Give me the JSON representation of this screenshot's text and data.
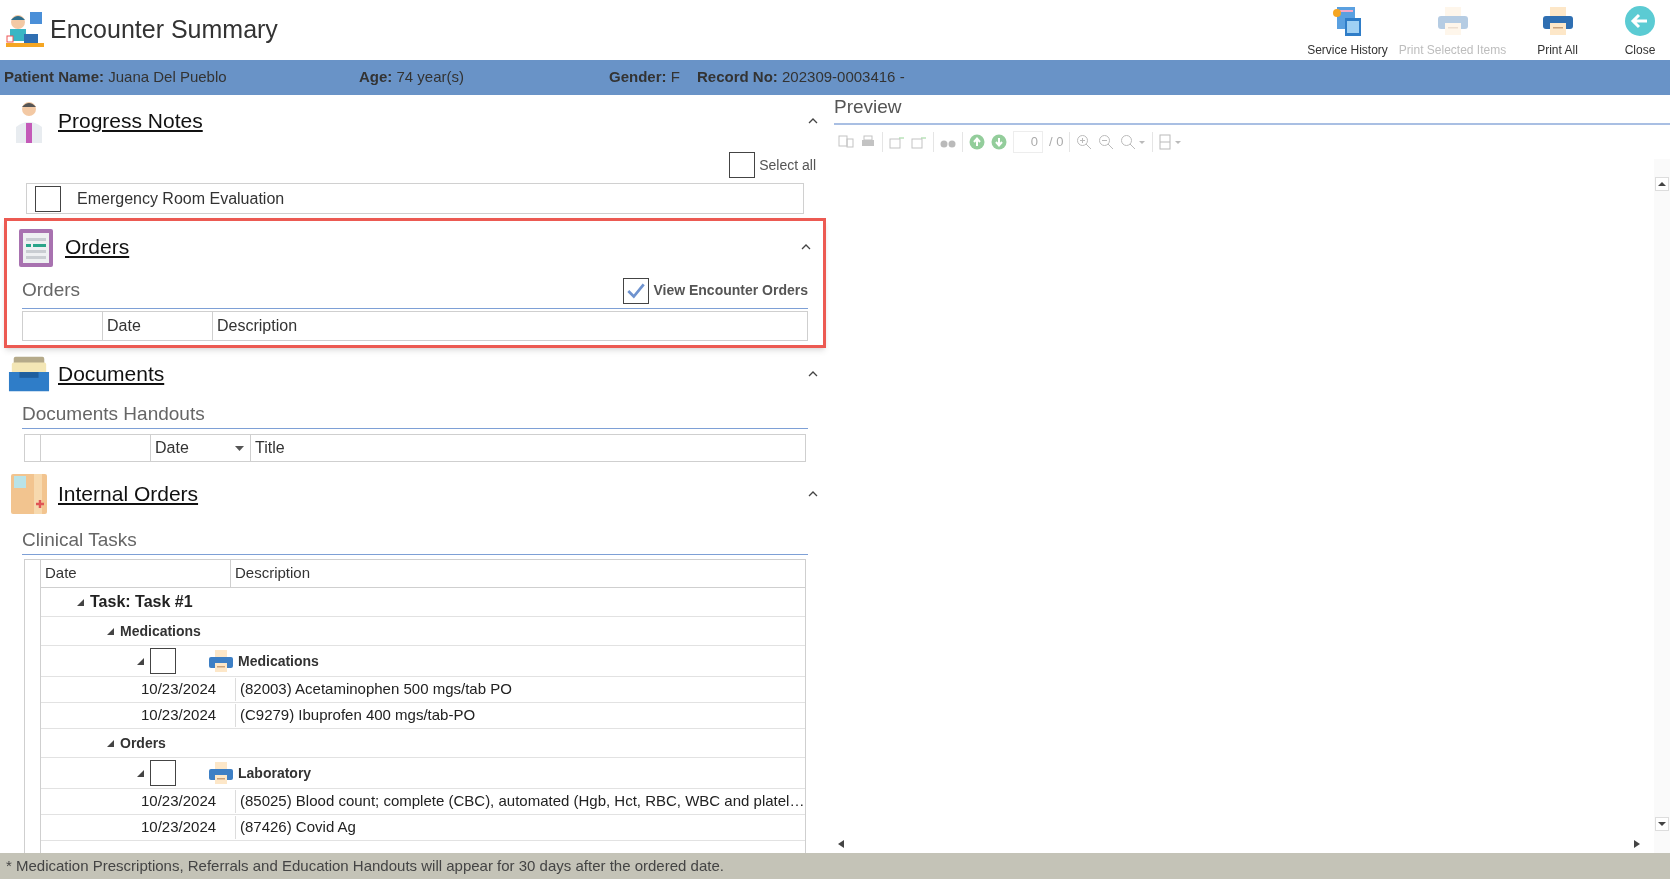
{
  "header": {
    "title": "Encounter Summary",
    "toolbar_buttons": [
      {
        "kind": "history",
        "label": "Service History",
        "disabled": false
      },
      {
        "kind": "print",
        "label": "Print Selected Items",
        "disabled": true
      },
      {
        "kind": "print",
        "label": "Print All",
        "disabled": false
      },
      {
        "kind": "close",
        "label": "Close",
        "disabled": false
      }
    ]
  },
  "patient_bar": [
    {
      "label": "Patient Name:",
      "value": "Juana Del Pueblo"
    },
    {
      "label": "Age:",
      "value": "74 year(s)"
    },
    {
      "label": "Gender:",
      "value": "F"
    },
    {
      "label": "Record No:",
      "value": "202309-0003416 -"
    }
  ],
  "progress_notes": {
    "title": "Progress Notes",
    "expanded": true,
    "select_all": {
      "label": "Select all",
      "checked": false
    },
    "items": [
      {
        "label": "Emergency Room Evaluation",
        "checked": false
      }
    ]
  },
  "orders": {
    "title": "Orders",
    "expanded": true,
    "highlighted": true,
    "subtitle": "Orders",
    "view_encounter_orders": {
      "label": "View Encounter Orders",
      "checked": true
    },
    "columns": [
      "Date",
      "Description"
    ]
  },
  "documents": {
    "title": "Documents",
    "expanded": true,
    "subtitle": "Documents Handouts",
    "columns": [
      {
        "label": "Date",
        "sortable": true
      },
      {
        "label": "Title",
        "sortable": false
      }
    ]
  },
  "internal_orders": {
    "title": "Internal Orders",
    "expanded": true,
    "subtitle": "Clinical Tasks",
    "columns": [
      "Date",
      "Description"
    ],
    "tree": [
      {
        "kind": "task",
        "label": "Task: Task #1",
        "expanded": true,
        "children": [
          {
            "kind": "group",
            "label": "Medications",
            "expanded": true,
            "children": [
              {
                "kind": "category",
                "label": "Medications",
                "expanded": true,
                "checked": false,
                "children": [
                  {
                    "kind": "item",
                    "date": "10/23/2024",
                    "description": "(82003) Acetaminophen 500 mgs/tab PO"
                  },
                  {
                    "kind": "item",
                    "date": "10/23/2024",
                    "description": "(C9279) Ibuprofen 400 mgs/tab-PO"
                  }
                ]
              }
            ]
          },
          {
            "kind": "group",
            "label": "Orders",
            "expanded": true,
            "children": [
              {
                "kind": "category",
                "label": "Laboratory",
                "expanded": true,
                "checked": false,
                "children": [
                  {
                    "kind": "item",
                    "date": "10/23/2024",
                    "description": "(85025) Blood count; complete (CBC), automated (Hgb, Hct, RBC, WBC and platel…"
                  },
                  {
                    "kind": "item",
                    "date": "10/23/2024",
                    "description": "(87426) Covid Ag"
                  }
                ]
              }
            ]
          }
        ]
      }
    ]
  },
  "preview": {
    "title": "Preview",
    "page_field": "0",
    "page_total": "/ 0"
  },
  "footer_note": "* Medication Prescriptions, Referrals and Education Handouts will appear for 30 days after the ordered date."
}
